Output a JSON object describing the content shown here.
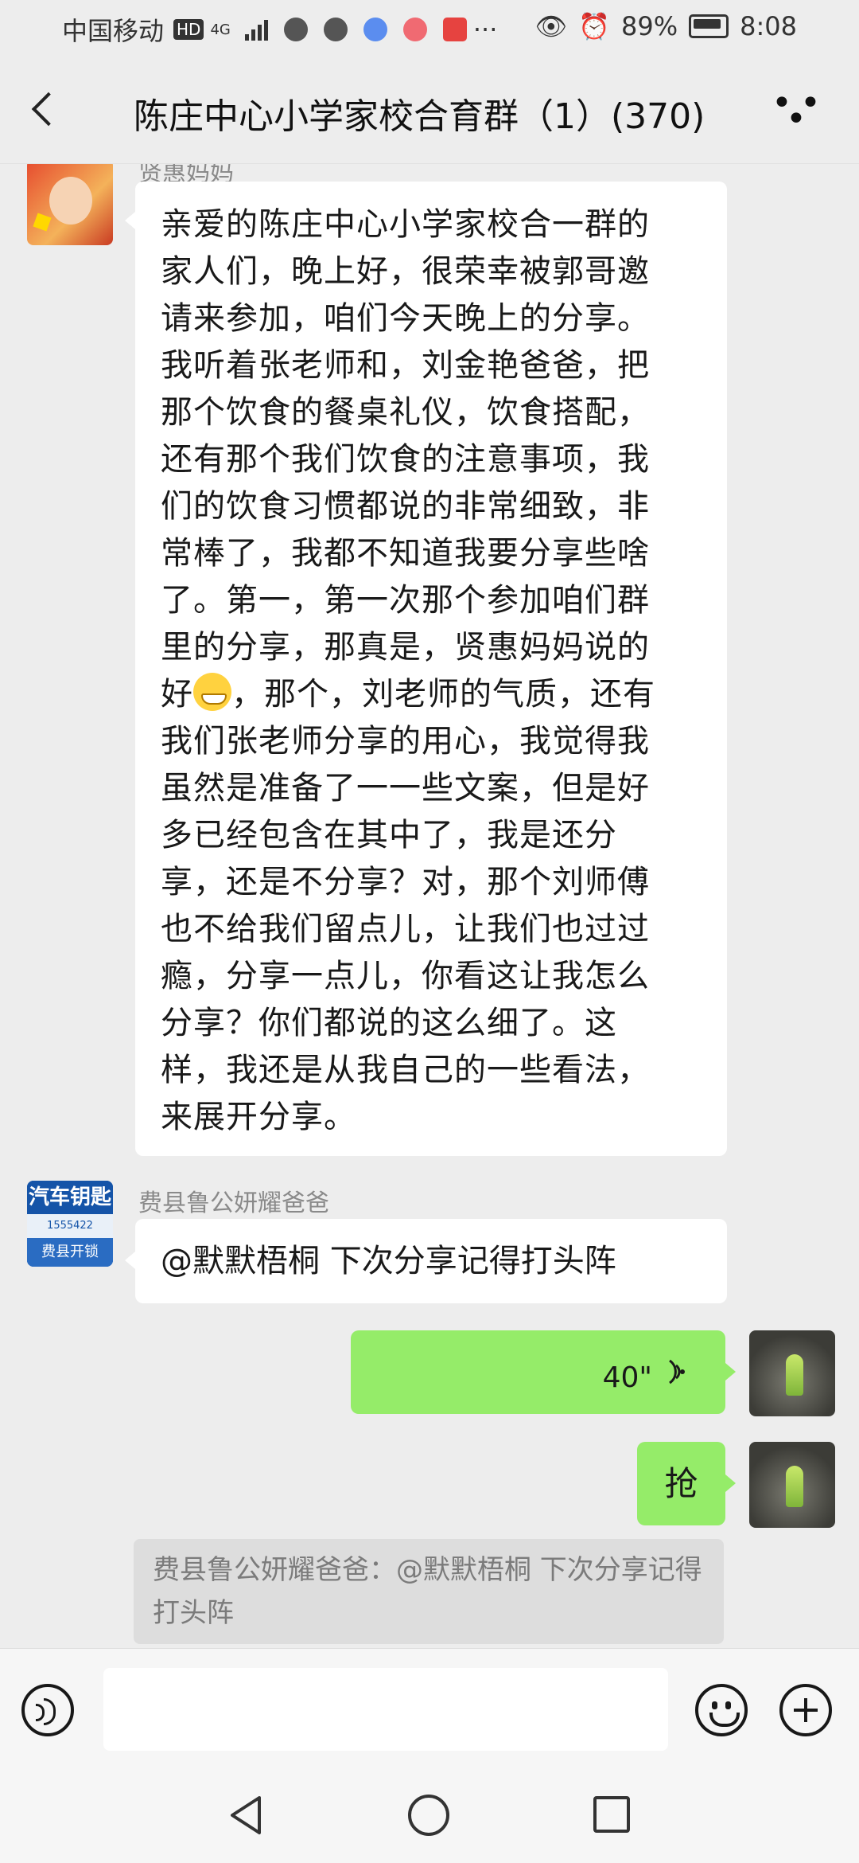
{
  "status_bar": {
    "carrier": "中国移动",
    "hd_badge": "HD",
    "network": "4G",
    "battery_percent": "89%",
    "time": "8:08"
  },
  "header": {
    "title": "陈庄中心小学家校合育群（1）(370)",
    "back_icon": "back-arrow-icon",
    "more_icon": "more-dots-icon"
  },
  "messages": [
    {
      "sender": "贤惠妈妈",
      "text_before_emoji": "亲爱的陈庄中心小学家校合一群的\n家人们，晚上好，很荣幸被郭哥邀\n请来参加，咱们今天晚上的分享。\n我听着张老师和，刘金艳爸爸，把\n那个饮食的餐桌礼仪，饮食搭配，\n还有那个我们饮食的注意事项，我\n们的饮食习惯都说的非常细致，非\n常棒了，我都不知道我要分享些啥\n了。第一，第一次那个参加咱们群\n里的分享，那真是，贤惠妈妈说的\n好",
      "emoji": "grinning-emoji",
      "text_after_emoji": "，那个，刘老师的气质，还有\n我们张老师分享的用心，我觉得我\n虽然是准备了一一些文案，但是好\n多已经包含在其中了，我是还分\n享，还是不分享？对，那个刘师傅\n也不给我们留点儿，让我们也过过\n瘾，分享一点儿，你看这让我怎么\n分享？你们都说的这么细了。这\n样，我还是从我自己的一些看法，\n来展开分享。"
    },
    {
      "sender": "费县鲁公妍耀爸爸",
      "avatar_text": [
        "汽车钥匙",
        "1555422",
        "费县开锁"
      ],
      "text": "@默默梧桐  下次分享记得打头阵"
    },
    {
      "sender": "me",
      "type": "voice",
      "duration": "40\""
    },
    {
      "sender": "me",
      "text": "抢"
    }
  ],
  "quote": {
    "text": "费县鲁公妍耀爸爸：@默默梧桐 下次分享记得打头阵"
  },
  "input_bar": {
    "value": "",
    "placeholder": ""
  },
  "colors": {
    "background": "#ededed",
    "my_bubble": "#95ec69",
    "their_bubble": "#ffffff"
  }
}
